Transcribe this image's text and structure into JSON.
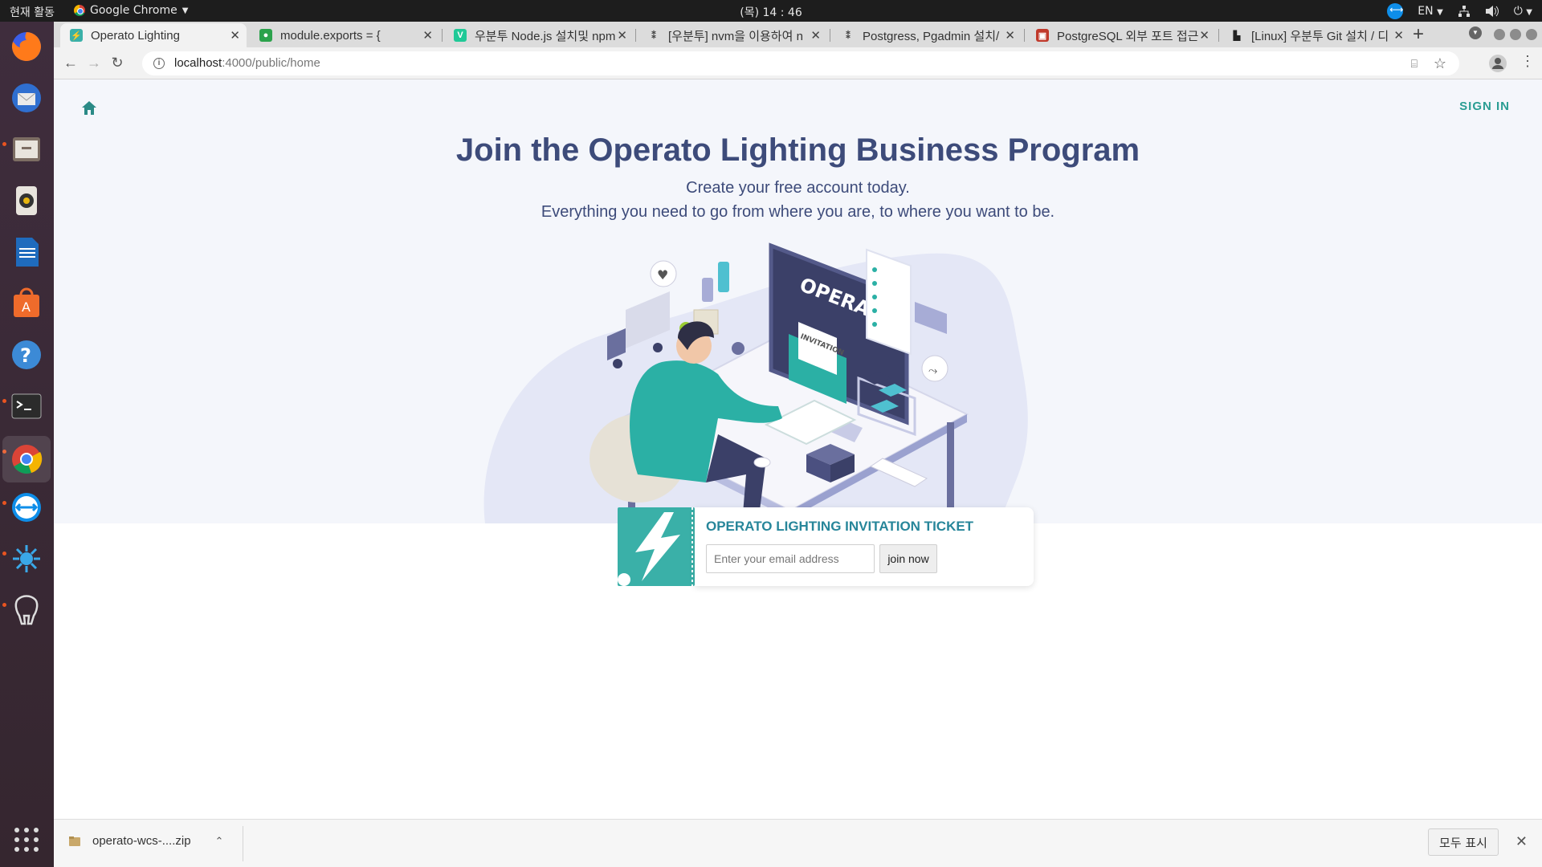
{
  "system": {
    "activities": "현재 활동",
    "app_name": "Google Chrome",
    "clock": "(목) 14 : 46",
    "lang": "EN"
  },
  "tabs": [
    {
      "title": "Operato Lighting",
      "favicon_color": "#3ab0a8"
    },
    {
      "title": "module.exports = {",
      "favicon_color": "#2ba24c"
    },
    {
      "title": "우분투 Node.js 설치및 npm",
      "favicon_color": "#20c997"
    },
    {
      "title": "[우분투] nvm을 이용하여 n",
      "favicon_color": "#444444"
    },
    {
      "title": "Postgress, Pgadmin 설치/",
      "favicon_color": "#444444"
    },
    {
      "title": "PostgreSQL 외부 포트 접근",
      "favicon_color": "#c0392b"
    },
    {
      "title": "[Linux] 우분투 Git 설치 / 디",
      "favicon_color": "#222222"
    }
  ],
  "address": {
    "host": "localhost",
    "path": ":4000/public/home"
  },
  "page": {
    "sign_in": "SIGN IN",
    "headline": "Join the Operato Lighting Business Program",
    "sub1": "Create your free account today.",
    "sub2": "Everything you need to go from where you are, to where you want to be.",
    "monitor_brand": "OPERATO",
    "envelope_label": "INVITATION",
    "ticket_title": "OPERATO LIGHTING INVITATION TICKET",
    "email_placeholder": "Enter your email address",
    "join_label": "join now"
  },
  "downloads": {
    "file": "operato-wcs-....zip",
    "show_all": "모두 표시"
  },
  "colors": {
    "accent": "#2a9d93",
    "headline": "#3d4b7a",
    "teal": "#3ab0a8"
  }
}
